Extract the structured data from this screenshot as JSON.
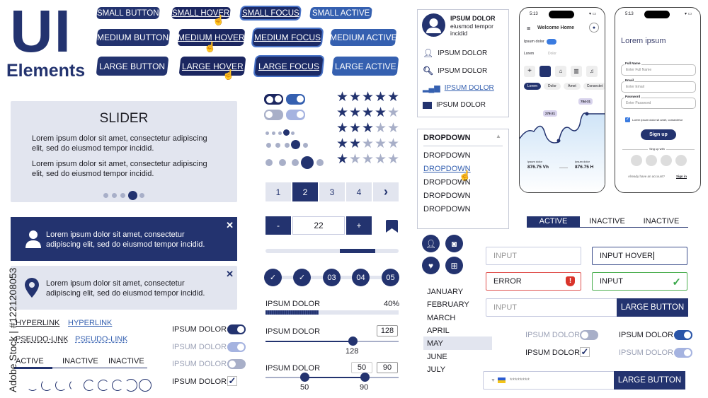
{
  "header": {
    "title_big": "UI",
    "title_sub": "Elements"
  },
  "buttons": {
    "small": [
      "SMALL BUTTON",
      "SMALL HOVER",
      "SMALL FOCUS",
      "SMALL ACTIVE"
    ],
    "medium": [
      "MEDIUM BUTTON",
      "MEDIUM HOVER",
      "MEDIUM FOCUS",
      "MEDIUM ACTIVE"
    ],
    "large": [
      "LARGE BUTTON",
      "LARGE HOVER",
      "LARGE FOCUS",
      "LARGE ACTIVE"
    ]
  },
  "slider_card": {
    "title": "SLIDER",
    "para1": "Lorem ipsum dolor sit amet, consectetur adipiscing elit, sed do eiusmod tempor incidid.",
    "para2": "Lorem ipsum dolor sit amet, consectetur adipiscing elit, sed do eiusmod tempor incidid.",
    "active_dot": 4,
    "dot_count": 5
  },
  "alerts": [
    {
      "icon": "user-icon",
      "text": "Lorem ipsum dolor sit amet, consectetur adipiscing elit, sed do eiusmod tempor incidid.",
      "close": "✕"
    },
    {
      "icon": "location-pin-icon",
      "text": "Lorem ipsum dolor sit amet, consectetur adipiscing elit, sed do eiusmod tempor incidid.",
      "close": "✕"
    }
  ],
  "links": {
    "hyperlink": "HYPERLINK",
    "hyperlink_active": "HYPERLINK",
    "pseudo": "PSEUDO-LINK",
    "pseudo_active": "PSEUDO-LINK"
  },
  "tabs_left": [
    "ACTIVE",
    "INACTIVE",
    "INACTIVE"
  ],
  "toggles_left": [
    {
      "label": "IPSUM DOLOR",
      "state": "on"
    },
    {
      "label": "IPSUM DOLOR",
      "state": "on-disabled"
    },
    {
      "label": "IPSUM DOLOR",
      "state": "off-disabled"
    },
    {
      "label": "IPSUM DOLOR",
      "state": "checked"
    }
  ],
  "ratings": [
    5,
    4,
    3,
    2,
    1
  ],
  "pagination": {
    "pages": [
      "1",
      "2",
      "3",
      "4"
    ],
    "current": "2",
    "next": "›"
  },
  "stepper": {
    "minus": "-",
    "value": "22",
    "plus": "+"
  },
  "scroll_progress": 0.6,
  "steps": [
    "✓",
    "✓",
    "03",
    "04",
    "05"
  ],
  "progress": {
    "label": "IPSUM DOLOR",
    "value_text": "40%",
    "value": 40
  },
  "range1": {
    "label": "IPSUM DOLOR",
    "value": "128",
    "value_label": "128"
  },
  "range2": {
    "label": "IPSUM DOLOR",
    "min_value": "50",
    "max_value": "90"
  },
  "profile_menu": {
    "name": "IPSUM DOLOR",
    "sub": "eiusmod tempor incidid",
    "items": [
      "IPSUM DOLOR",
      "IPSUM DOLOR",
      "IPSUM DOLOR",
      "IPSUM DOLOR"
    ],
    "active_index": 2
  },
  "dropdown": {
    "header": "DROPDOWN",
    "items": [
      "DROPDOWN",
      "DROPDOWN",
      "DROPDOWN",
      "DROPDOWN",
      "DROPDOWN"
    ],
    "hover_index": 1
  },
  "phone1": {
    "time": "5:13",
    "title": "Welcome Home",
    "toggle_label": "Ipsum dolor",
    "tab1": "Lorem",
    "tab2": "Dolor",
    "chips": [
      "Lorem",
      "Dolor",
      "Amet",
      "Consectet"
    ],
    "tag1": "278-21",
    "tag2": "784-31",
    "stat1_label": "Ipsum dolor",
    "stat1_value": "876.75 Vh",
    "stat2_label": "Ipsum dolor",
    "stat2_value": "876.75 H"
  },
  "phone2": {
    "time": "5:13",
    "title": "Lorem ipsum",
    "fields": [
      {
        "label": "Full Name",
        "placeholder": "Enter Full Name"
      },
      {
        "label": "Email",
        "placeholder": "Enter Email"
      },
      {
        "label": "Password",
        "placeholder": "Enter Password"
      }
    ],
    "checkbox_text": "Lorem ipsum dolor sit amet, consectetur",
    "signup": "Sign up",
    "signup_with": "Sing up with",
    "already": "Already have an account?",
    "signin": "Sign in"
  },
  "tabs_right": [
    "ACTIVE",
    "INACTIVE",
    "INACTIVE"
  ],
  "inputs": {
    "input1_placeholder": "INPUT",
    "hover_value": "INPUT HOVER",
    "error_value": "ERROR",
    "success_value": "INPUT",
    "combo_placeholder": "INPUT",
    "combo_button": "LARGE BUTTON",
    "phone_value": "********",
    "phone_button": "LARGE BUTTON"
  },
  "months": [
    "JANUARY",
    "FEBRUARY",
    "MARCH",
    "APRIL",
    "MAY",
    "JUNE",
    "JULY"
  ],
  "selected_month": "MAY",
  "toggles_right": [
    {
      "label": "IPSUM DOLOR",
      "state": "off-disabled"
    },
    {
      "label": "IPSUM DOLOR",
      "state": "on"
    },
    {
      "label": "IPSUM DOLOR",
      "state": "checked"
    },
    {
      "label": "IPSUM DOLOR",
      "state": "on-disabled"
    }
  ],
  "watermark": "Adobe Stock | #1221208053",
  "colors": {
    "navy": "#23336f",
    "active_blue": "#3560b0",
    "light_bg": "#e2e5ef",
    "error": "#e0524f",
    "success": "#4caf50"
  }
}
